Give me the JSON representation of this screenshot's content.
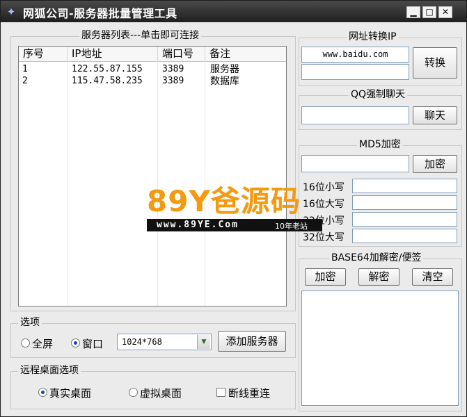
{
  "window": {
    "title": "网狐公司-服务器批量管理工具",
    "buttons": {
      "minimize": "▁",
      "maximize": "□",
      "close": "✕"
    }
  },
  "server_list": {
    "title": "服务器列表---单击即可连接",
    "columns": [
      "序号",
      "IP地址",
      "端口号",
      "备注"
    ],
    "rows": [
      {
        "index": "1",
        "ip": "122.55.87.155",
        "port": "3389",
        "note": "服务器"
      },
      {
        "index": "2",
        "ip": "115.47.58.235",
        "port": "3389",
        "note": "数据库"
      }
    ]
  },
  "options": {
    "title": "选项",
    "fullscreen_label": "全屏",
    "window_label": "窗口",
    "selected_mode": "窗口",
    "resolution": "1024*768",
    "add_server_label": "添加服务器"
  },
  "remote_desktop": {
    "title": "远程桌面选项",
    "real_desktop_label": "真实桌面",
    "virtual_desktop_label": "虚拟桌面",
    "reconnect_label": "断线重连",
    "selected": "真实桌面",
    "reconnect_checked": false
  },
  "url_to_ip": {
    "title": "网址转换IP",
    "url_value": "www.baidu.com",
    "ip_value": "",
    "convert_label": "转换"
  },
  "qq_chat": {
    "title": "QQ强制聊天",
    "qq_value": "",
    "chat_label": "聊天"
  },
  "md5": {
    "title": "MD5加密",
    "input_value": "",
    "encrypt_label": "加密",
    "rows": [
      {
        "label": "16位小写",
        "value": ""
      },
      {
        "label": "16位大写",
        "value": ""
      },
      {
        "label": "32位小写",
        "value": ""
      },
      {
        "label": "32位大写",
        "value": ""
      }
    ]
  },
  "base64": {
    "title": "BASE64加解密/便签",
    "encrypt_label": "加密",
    "decrypt_label": "解密",
    "clear_label": "清空",
    "notes_value": ""
  },
  "watermark": {
    "logo": "89Y爸源码",
    "url": "www.89YE.Com",
    "tagline": "10年老站"
  },
  "colors": {
    "titlebar": "#2a2a2a",
    "accent": "#1f3fb8",
    "watermark_orange": "#f39a10"
  }
}
